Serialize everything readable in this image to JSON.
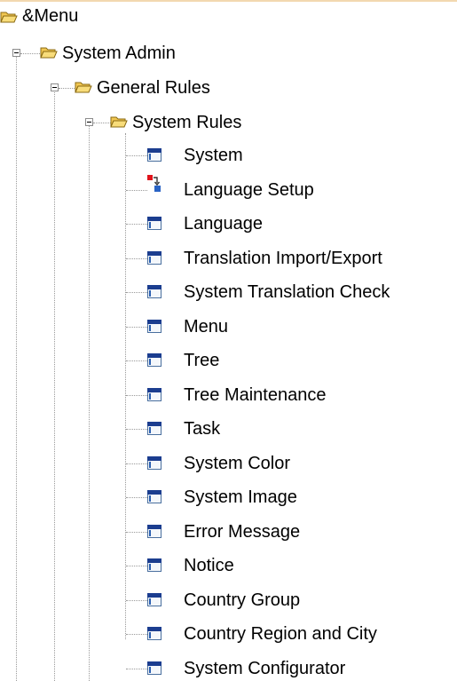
{
  "tree": {
    "root": {
      "label": "&Menu",
      "icon": "open-folder-icon",
      "children": [
        {
          "label": "System Admin",
          "icon": "open-folder-icon",
          "expanded": true,
          "children": [
            {
              "label": "General Rules",
              "icon": "open-folder-icon",
              "expanded": true,
              "children": [
                {
                  "label": "System Rules",
                  "icon": "open-folder-icon",
                  "expanded": true,
                  "items": [
                    {
                      "label": "System",
                      "icon": "window-form-icon"
                    },
                    {
                      "label": "Language Setup",
                      "icon": "process-flow-icon"
                    },
                    {
                      "label": "Language",
                      "icon": "window-form-icon"
                    },
                    {
                      "label": "Translation Import/Export",
                      "icon": "window-form-icon"
                    },
                    {
                      "label": "System Translation Check",
                      "icon": "window-form-icon"
                    },
                    {
                      "label": "Menu",
                      "icon": "window-form-icon"
                    },
                    {
                      "label": "Tree",
                      "icon": "window-form-icon"
                    },
                    {
                      "label": "Tree Maintenance",
                      "icon": "window-form-icon"
                    },
                    {
                      "label": "Task",
                      "icon": "window-form-icon"
                    },
                    {
                      "label": "System Color",
                      "icon": "window-form-icon"
                    },
                    {
                      "label": "System Image",
                      "icon": "window-form-icon"
                    },
                    {
                      "label": "Error Message",
                      "icon": "window-form-icon"
                    },
                    {
                      "label": "Notice",
                      "icon": "window-form-icon"
                    },
                    {
                      "label": "Country Group",
                      "icon": "window-form-icon"
                    },
                    {
                      "label": "Country Region and City",
                      "icon": "window-form-icon"
                    },
                    {
                      "label": "System Configurator",
                      "icon": "window-form-icon"
                    }
                  ]
                }
              ]
            }
          ]
        }
      ]
    }
  },
  "colors": {
    "folder_fill": "#f6d36b",
    "folder_outline": "#8a6a12",
    "window_titlebar": "#1b3d8f",
    "tree_lines": "#9a9a9a",
    "top_border": "#f2d8b0"
  }
}
